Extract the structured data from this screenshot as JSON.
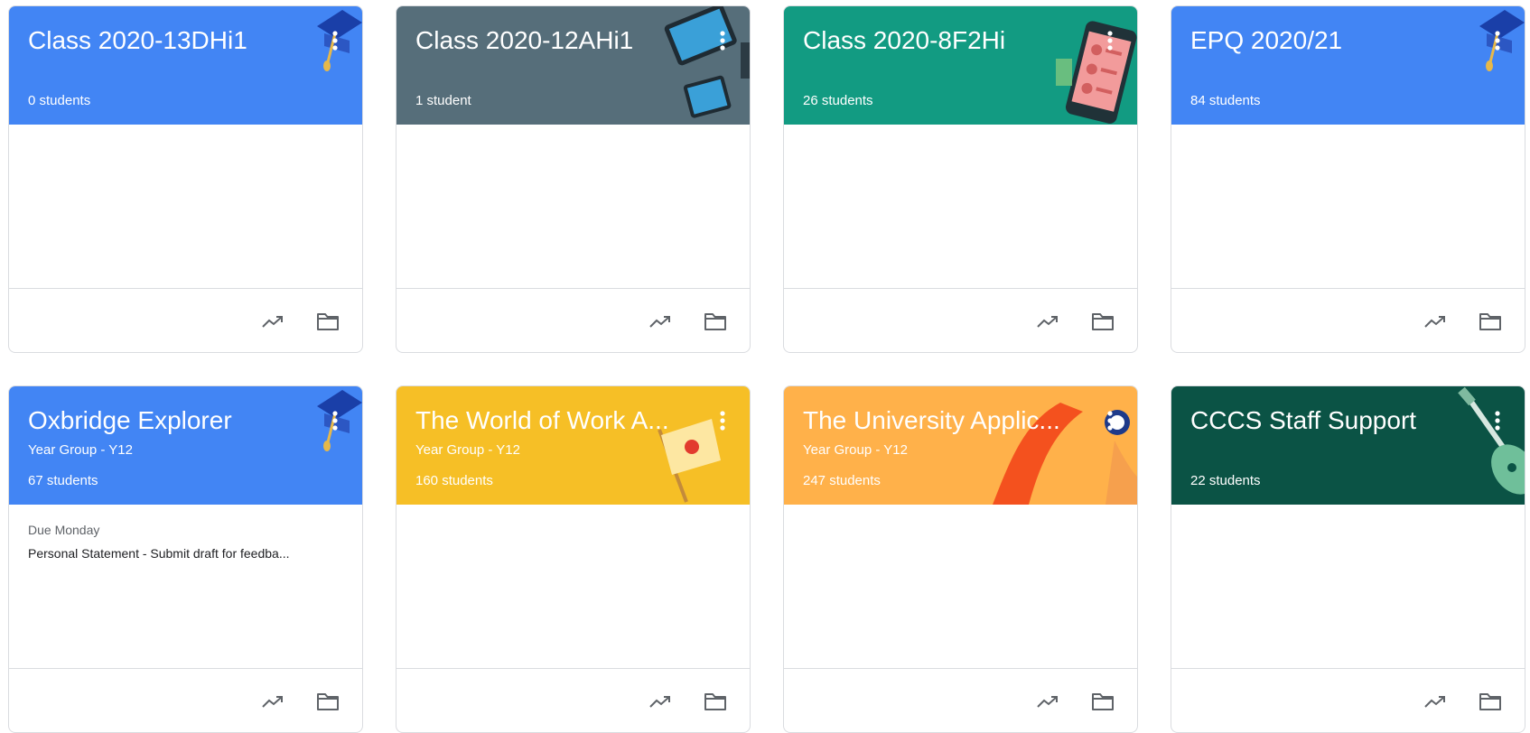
{
  "colors": {
    "blue": "#4285f4",
    "slate": "#566e7a",
    "teal": "#129b82",
    "yellow": "#f6bf26",
    "orange": "#ffb14a",
    "darkgreen": "#0b5345",
    "icon": "#5f6368"
  },
  "cards": [
    {
      "title": "Class 2020-13DHi1",
      "section": "",
      "students": "0 students",
      "due_label": "",
      "due_item": "",
      "color": "blue",
      "art": "graduation-cap-icon"
    },
    {
      "title": "Class 2020-12AHi1",
      "section": "",
      "students": "1 student",
      "due_label": "",
      "due_item": "",
      "color": "slate",
      "art": "tablets-icon"
    },
    {
      "title": "Class 2020-8F2Hi",
      "section": "",
      "students": "26 students",
      "due_label": "",
      "due_item": "",
      "color": "teal",
      "art": "phone-icon"
    },
    {
      "title": "EPQ 2020/21",
      "section": "",
      "students": "84 students",
      "due_label": "",
      "due_item": "",
      "color": "blue",
      "art": "graduation-cap-icon"
    },
    {
      "title": "Oxbridge Explorer",
      "section": "Year Group - Y12",
      "students": "67 students",
      "due_label": "Due Monday",
      "due_item": "Personal Statement - Submit draft for feedba...",
      "color": "blue",
      "art": "graduation-cap-icon"
    },
    {
      "title": "The World of Work A...",
      "section": "Year Group - Y12",
      "students": "160 students",
      "due_label": "",
      "due_item": "",
      "color": "yellow",
      "art": "flag-icon"
    },
    {
      "title": "The University Applic...",
      "section": "Year Group - Y12",
      "students": "247 students",
      "due_label": "",
      "due_item": "",
      "color": "orange",
      "art": "paint-stroke-icon"
    },
    {
      "title": "CCCS Staff Support",
      "section": "",
      "students": "22 students",
      "due_label": "",
      "due_item": "",
      "color": "darkgreen",
      "art": "guitar-icon"
    }
  ]
}
